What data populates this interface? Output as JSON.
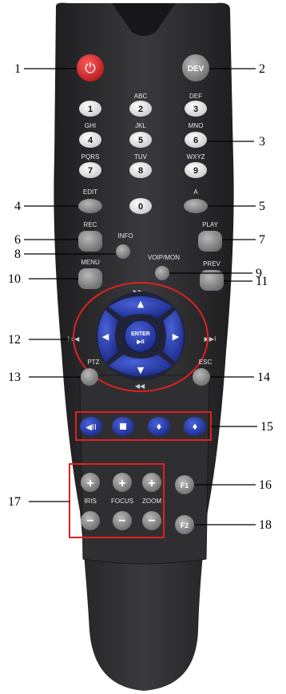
{
  "power": "⏻",
  "dev": "DEV",
  "numpad": [
    {
      "digit": "1",
      "letters": ""
    },
    {
      "digit": "2",
      "letters": "ABC"
    },
    {
      "digit": "3",
      "letters": "DEF"
    },
    {
      "digit": "4",
      "letters": "GHI"
    },
    {
      "digit": "5",
      "letters": "JKL"
    },
    {
      "digit": "6",
      "letters": "MNO"
    },
    {
      "digit": "7",
      "letters": "PQRS"
    },
    {
      "digit": "8",
      "letters": "TUV"
    },
    {
      "digit": "9",
      "letters": "WXYZ"
    },
    {
      "digit": "0",
      "letters": ""
    }
  ],
  "labels": {
    "edit": "EDIT",
    "a": "A",
    "rec": "REC",
    "info": "INFO",
    "play": "PLAY",
    "voipmon": "VOIP/MON",
    "menu": "MENU",
    "prev": "PREV",
    "ptz": "PTZ",
    "esc": "ESC",
    "enter": "ENTER",
    "enter_sub": "▶II",
    "iris": "IRIS",
    "focus": "FOCUS",
    "zoom": "ZOOM",
    "f1": "F1",
    "f2": "F2",
    "plus": "+",
    "minus": "−"
  },
  "callouts": [
    "1",
    "2",
    "3",
    "4",
    "5",
    "6",
    "7",
    "8",
    "9",
    "10",
    "11",
    "12",
    "13",
    "14",
    "15",
    "16",
    "17",
    "18"
  ],
  "colors": {
    "body": "#2b2b2d",
    "power": "#d8282c",
    "nav": "#2a3fa6",
    "callout_box": "#e02020"
  }
}
